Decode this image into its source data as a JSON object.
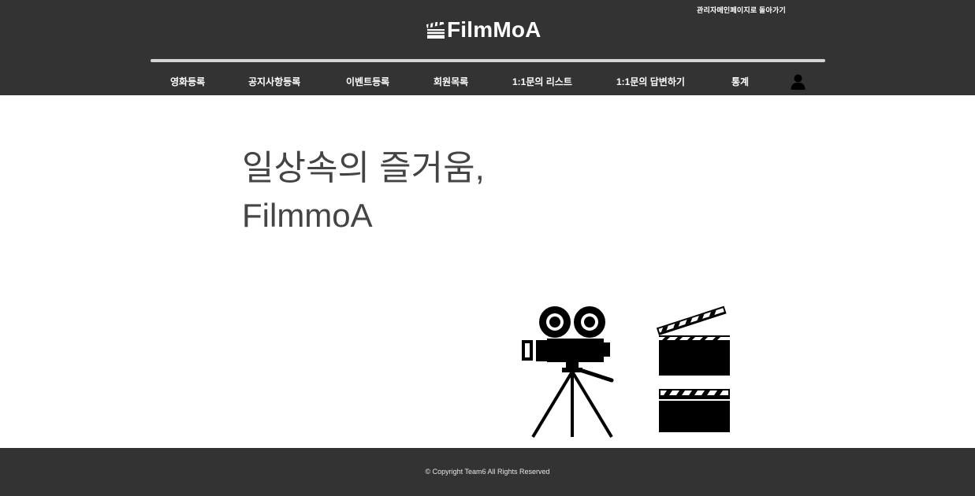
{
  "header": {
    "admin_link": "관리자메인페이지로 돌아가기",
    "logo_text": "FilmMoA",
    "logo_icon": "clapperboard-icon"
  },
  "nav": {
    "items": [
      {
        "label": "영화등록"
      },
      {
        "label": "공지사항등록"
      },
      {
        "label": "이벤트등록"
      },
      {
        "label": "회원목록"
      },
      {
        "label": "1:1문의 리스트"
      },
      {
        "label": "1:1문의 답변하기"
      },
      {
        "label": "통계"
      }
    ],
    "user_icon": "user-icon"
  },
  "hero": {
    "line1": "일상속의 즐거움,",
    "line2": "FilmmoA"
  },
  "illustration": {
    "icons": [
      "movie-camera-icon",
      "clapperboard-icon"
    ]
  },
  "footer": {
    "copyright": "© Copyright Team6 All Rights Reserved"
  },
  "colors": {
    "header_bg": "#333333",
    "footer_bg": "#333333",
    "hero_text": "#444444",
    "divider": "#d4d4d4"
  }
}
